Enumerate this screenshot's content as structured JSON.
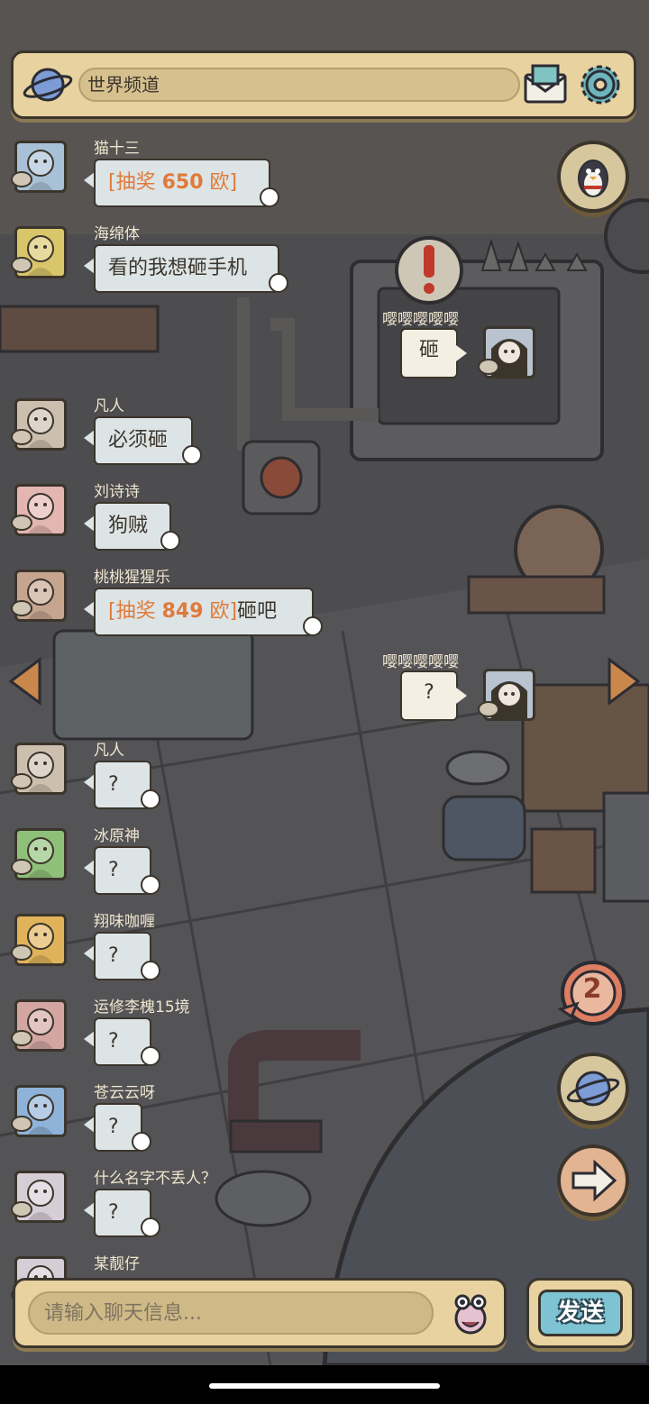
{
  "colors": {
    "accent_orange": "#e07a3a",
    "panel": "#e7d2a0",
    "send_blue": "#7ec3d3",
    "bg": "#4f4e4f"
  },
  "header": {
    "channel_title": "世界频道"
  },
  "messages": [
    {
      "name": "猫十三",
      "parts": [
        {
          "t": "[抽奖 ",
          "c": "br"
        },
        {
          "t": "650",
          "c": "amt"
        },
        {
          "t": " 欧]",
          "c": "br"
        }
      ]
    },
    {
      "name": "海绵体",
      "text": "看的我想砸手机"
    },
    {
      "name": "凡人",
      "text": "必须砸"
    },
    {
      "name": "刘诗诗",
      "text": "狗贼"
    },
    {
      "name": "桃桃猩猩乐",
      "parts": [
        {
          "t": "[抽奖 ",
          "c": "br"
        },
        {
          "t": "849",
          "c": "amt"
        },
        {
          "t": " 欧]",
          "c": "br"
        },
        {
          "t": "砸吧",
          "c": ""
        }
      ]
    },
    {
      "name": "凡人",
      "text": "?"
    },
    {
      "name": "冰原神",
      "text": "?"
    },
    {
      "name": "翔味咖喱",
      "text": "?"
    },
    {
      "name": "运修李槐15境",
      "text": "?"
    },
    {
      "name": "苍云云呀",
      "text": "?"
    },
    {
      "name": "什么名字不丢人？",
      "text": "?"
    },
    {
      "name": "某靓仔",
      "text": ""
    }
  ],
  "self_messages": [
    {
      "name": "嘤嘤嘤嘤嘤",
      "text": "砸"
    },
    {
      "name": "嘤嘤嘤嘤嘤",
      "text": "?"
    }
  ],
  "notification": {
    "count": "2"
  },
  "composer": {
    "placeholder": "请输入聊天信息...",
    "send_label": "发送"
  }
}
